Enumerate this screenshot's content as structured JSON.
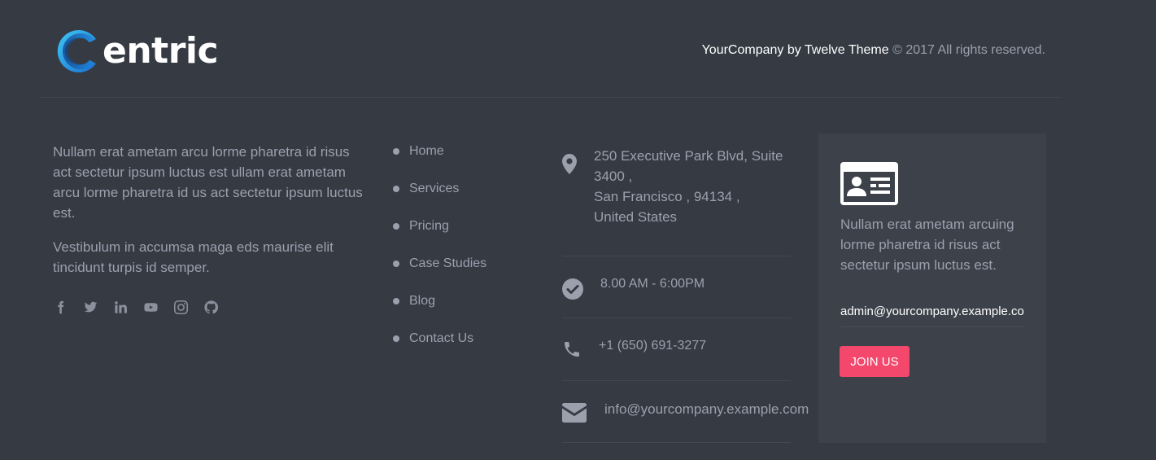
{
  "brand": {
    "name": "entric",
    "accent": "#2aa3e6"
  },
  "copyright": {
    "company": "YourCompany by Twelve Theme",
    "rest": "© 2017 All rights reserved."
  },
  "about": {
    "paragraph1": "Nullam erat ametam arcu lorme pharetra id risus act sectetur ipsum luctus est ullam erat ametam arcu lorme pharetra id us act sectetur ipsum luctus est.",
    "paragraph2": "Vestibulum in accumsa maga eds maurise elit tincidunt turpis id semper.",
    "social": [
      "facebook-icon",
      "twitter-icon",
      "linkedin-icon",
      "youtube-icon",
      "instagram-icon",
      "github-icon"
    ]
  },
  "links": {
    "items": [
      {
        "label": "Home"
      },
      {
        "label": "Services"
      },
      {
        "label": "Pricing"
      },
      {
        "label": "Case Studies"
      },
      {
        "label": "Blog"
      },
      {
        "label": "Contact Us"
      }
    ]
  },
  "contact": {
    "address_line1": "250 Executive Park Blvd, Suite",
    "address_line2": "3400 ,",
    "address_line3": "San Francisco , 94134 ,",
    "address_line4": "United States",
    "hours": "8.00 AM - 6:00PM",
    "phone": "+1 (650) 691-3277",
    "email": "info@yourcompany.example.com"
  },
  "signup": {
    "text": "Nullam erat ametam arcuing lorme pharetra id risus act sectetur ipsum luctus est.",
    "email_value": "admin@yourcompany.example.com",
    "button_label": "JOIN US",
    "button_color": "#f3476c"
  }
}
